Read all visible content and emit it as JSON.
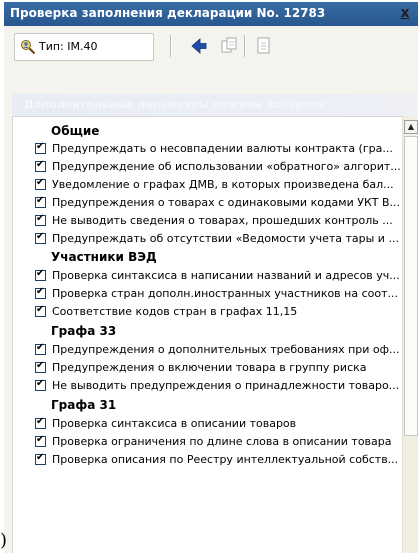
{
  "window": {
    "title": "Проверка заполнения декларации No. 12783",
    "close_glyph": "x"
  },
  "toolbar": {
    "type_label": "Тип: IM.40"
  },
  "section": {
    "title": "Дополнительные параметры режима контроля"
  },
  "groups": [
    {
      "title": "Общие",
      "items": [
        "Предупреждать о несовпадении валюты контракта (гра...",
        "Предупреждение об использовании «обратного» алгорит...",
        "Уведомление о графах ДМВ, в которых произведена бал...",
        "Предупреждения о товарах с одинаковыми кодами УКТ В...",
        "Не выводить сведения о товарах, прошедших контроль ...",
        "Предупреждать об отсутствии «Ведомости учета тары и ..."
      ]
    },
    {
      "title": "Участники ВЭД",
      "items": [
        "Проверка синтаксиса в написании названий и адресов уч...",
        "Проверка стран дополн.иностранных участников на соот...",
        "Соответствие кодов стран в графах 11,15"
      ]
    },
    {
      "title": "Графа 33",
      "items": [
        "Предупреждения о дополнительных требованиях при оф...",
        "Предупреждения о включении товара в группу риска",
        "Не выводить предупреждения о принадлежности товаро..."
      ]
    },
    {
      "title": "Графа 31",
      "items": [
        "Проверка синтаксиса в описании товаров",
        "Проверка ограничения по длине слова в описании товара",
        "Проверка описания по Реестру интеллектуальной собств..."
      ]
    }
  ],
  "edge_mark": ")",
  "icons": {
    "type": "search-user-icon",
    "back": "back-arrow-icon",
    "copy": "copy-icon",
    "page": "document-icon",
    "scroll_up": "scroll-up-arrow-icon",
    "check": "check-icon"
  },
  "colors": {
    "titlebar": "#2e5f96",
    "back_arrow": "#1f4fa8",
    "section_text": "#f4f6fb"
  }
}
